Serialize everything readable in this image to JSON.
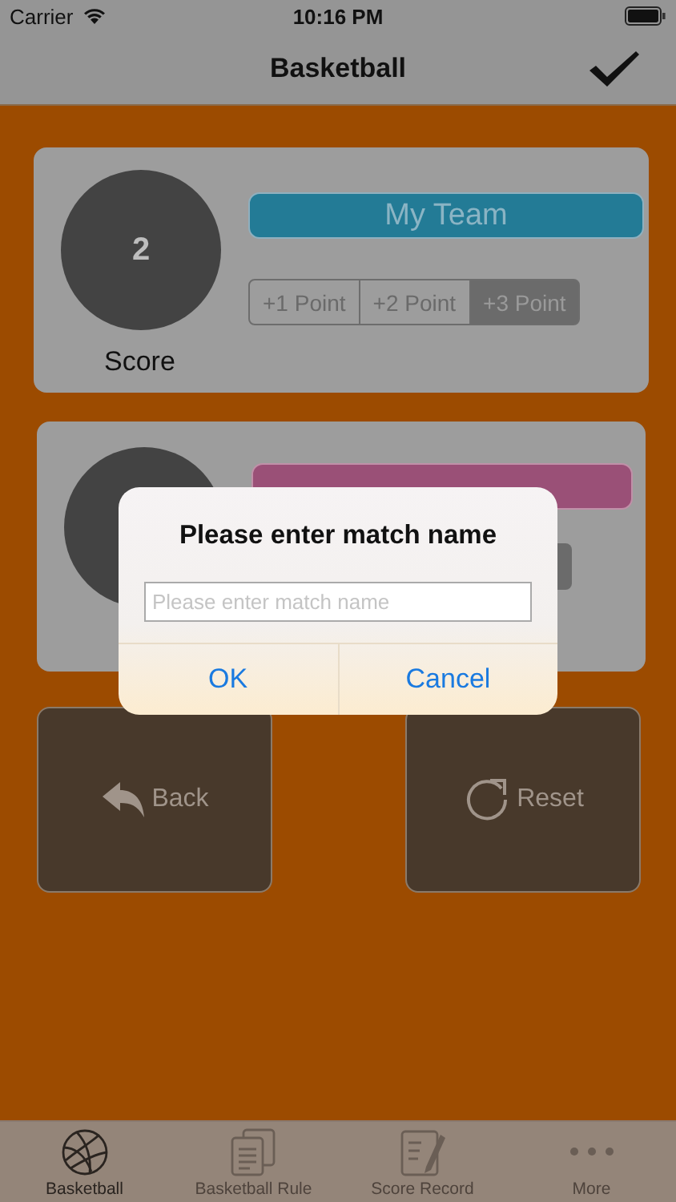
{
  "status_bar": {
    "carrier": "Carrier",
    "time": "10:16 PM"
  },
  "nav": {
    "title": "Basketball"
  },
  "teams": [
    {
      "score": "2",
      "score_label": "Score",
      "name": "My Team",
      "color": "#237b96",
      "points": [
        {
          "label": "+1 Point",
          "selected": false
        },
        {
          "label": "+2 Point",
          "selected": false
        },
        {
          "label": "+3 Point",
          "selected": true
        }
      ]
    },
    {
      "color": "#9a5077"
    }
  ],
  "actions": [
    {
      "kind": "back",
      "label": "Back"
    },
    {
      "kind": "reset",
      "label": "Reset"
    }
  ],
  "dialog": {
    "title": "Please enter match name",
    "placeholder": "Please enter match name",
    "buttons": [
      "OK",
      "Cancel"
    ]
  },
  "tabs": [
    {
      "kind": "ball",
      "label": "Basketball",
      "selected": true
    },
    {
      "kind": "rules",
      "label": "Basketball Rule",
      "selected": false
    },
    {
      "kind": "record",
      "label": "Score Record",
      "selected": false
    },
    {
      "kind": "more",
      "label": "More",
      "selected": false
    }
  ]
}
